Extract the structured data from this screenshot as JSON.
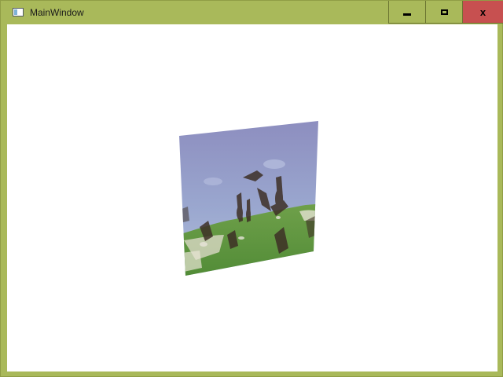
{
  "window": {
    "title": "MainWindow",
    "app_icon": "window-app-icon",
    "controls": {
      "minimize_icon": "minimize-icon",
      "maximize_icon": "maximize-icon",
      "close_icon": "close-icon",
      "close_glyph": "x"
    }
  },
  "colors": {
    "frame": "#a9b95a",
    "close_button": "#c75050",
    "client_background": "#ffffff"
  },
  "content": {
    "image_subject": "birds-over-grassy-hill-photo"
  }
}
